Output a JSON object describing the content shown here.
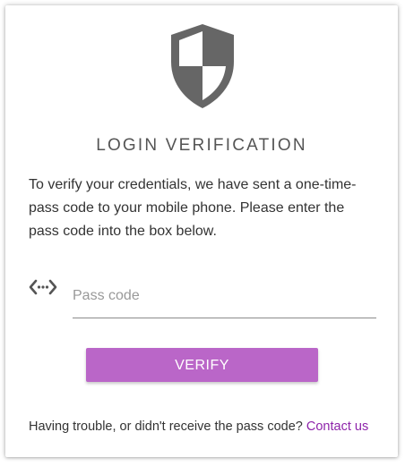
{
  "dialog": {
    "title": "LOGIN VERIFICATION",
    "instructions": "To verify your credentials, we have sent a one-time-pass code to your mobile phone. Please enter the pass code into the box below."
  },
  "pass_code_field": {
    "icon": "code-icon",
    "placeholder": "Pass code",
    "value": ""
  },
  "verify_button": {
    "label": "VERIFY"
  },
  "footer": {
    "text": "Having trouble, or didn't receive the pass code?",
    "link_label": "Contact us"
  },
  "colors": {
    "accent": "#ba66c8",
    "link": "#8e24aa",
    "shield": "#666666"
  }
}
